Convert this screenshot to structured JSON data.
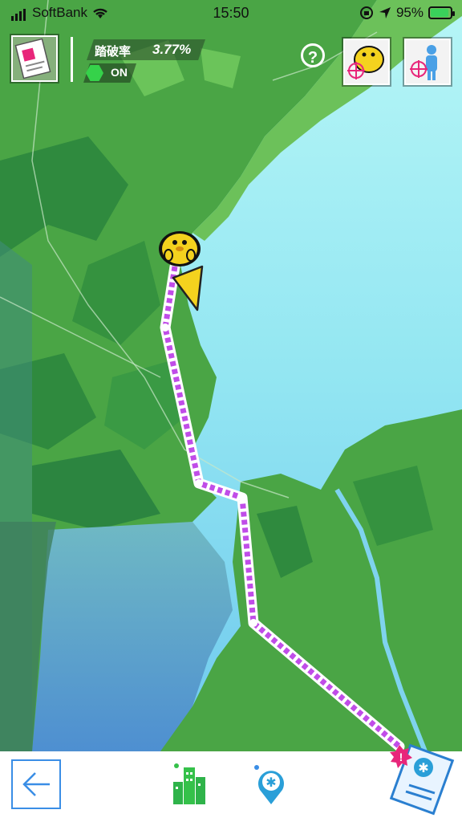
{
  "status_bar": {
    "carrier": "SoftBank",
    "time": "15:50",
    "battery_percent": "95%"
  },
  "hud": {
    "rate_label": "踏破率",
    "rate_value": "3.77%",
    "mode_status": "ON",
    "help_label": "?"
  },
  "icons": {
    "document": "document-icon",
    "buddy": "yellow-buddy-target-icon",
    "person": "person-target-icon",
    "back": "back-arrow-icon",
    "city": "city-buildings-icon",
    "map_pin": "map-pin-icon",
    "ticket": "ticket-icon"
  },
  "colors": {
    "land": "#4ea84a",
    "land_dark": "#2f8a3e",
    "water": "#8ee3f0",
    "route": "#c04de8",
    "accent_blue": "#3a8ee6",
    "badge": "#e8267a"
  },
  "badges": {
    "ticket_alert": "!"
  }
}
